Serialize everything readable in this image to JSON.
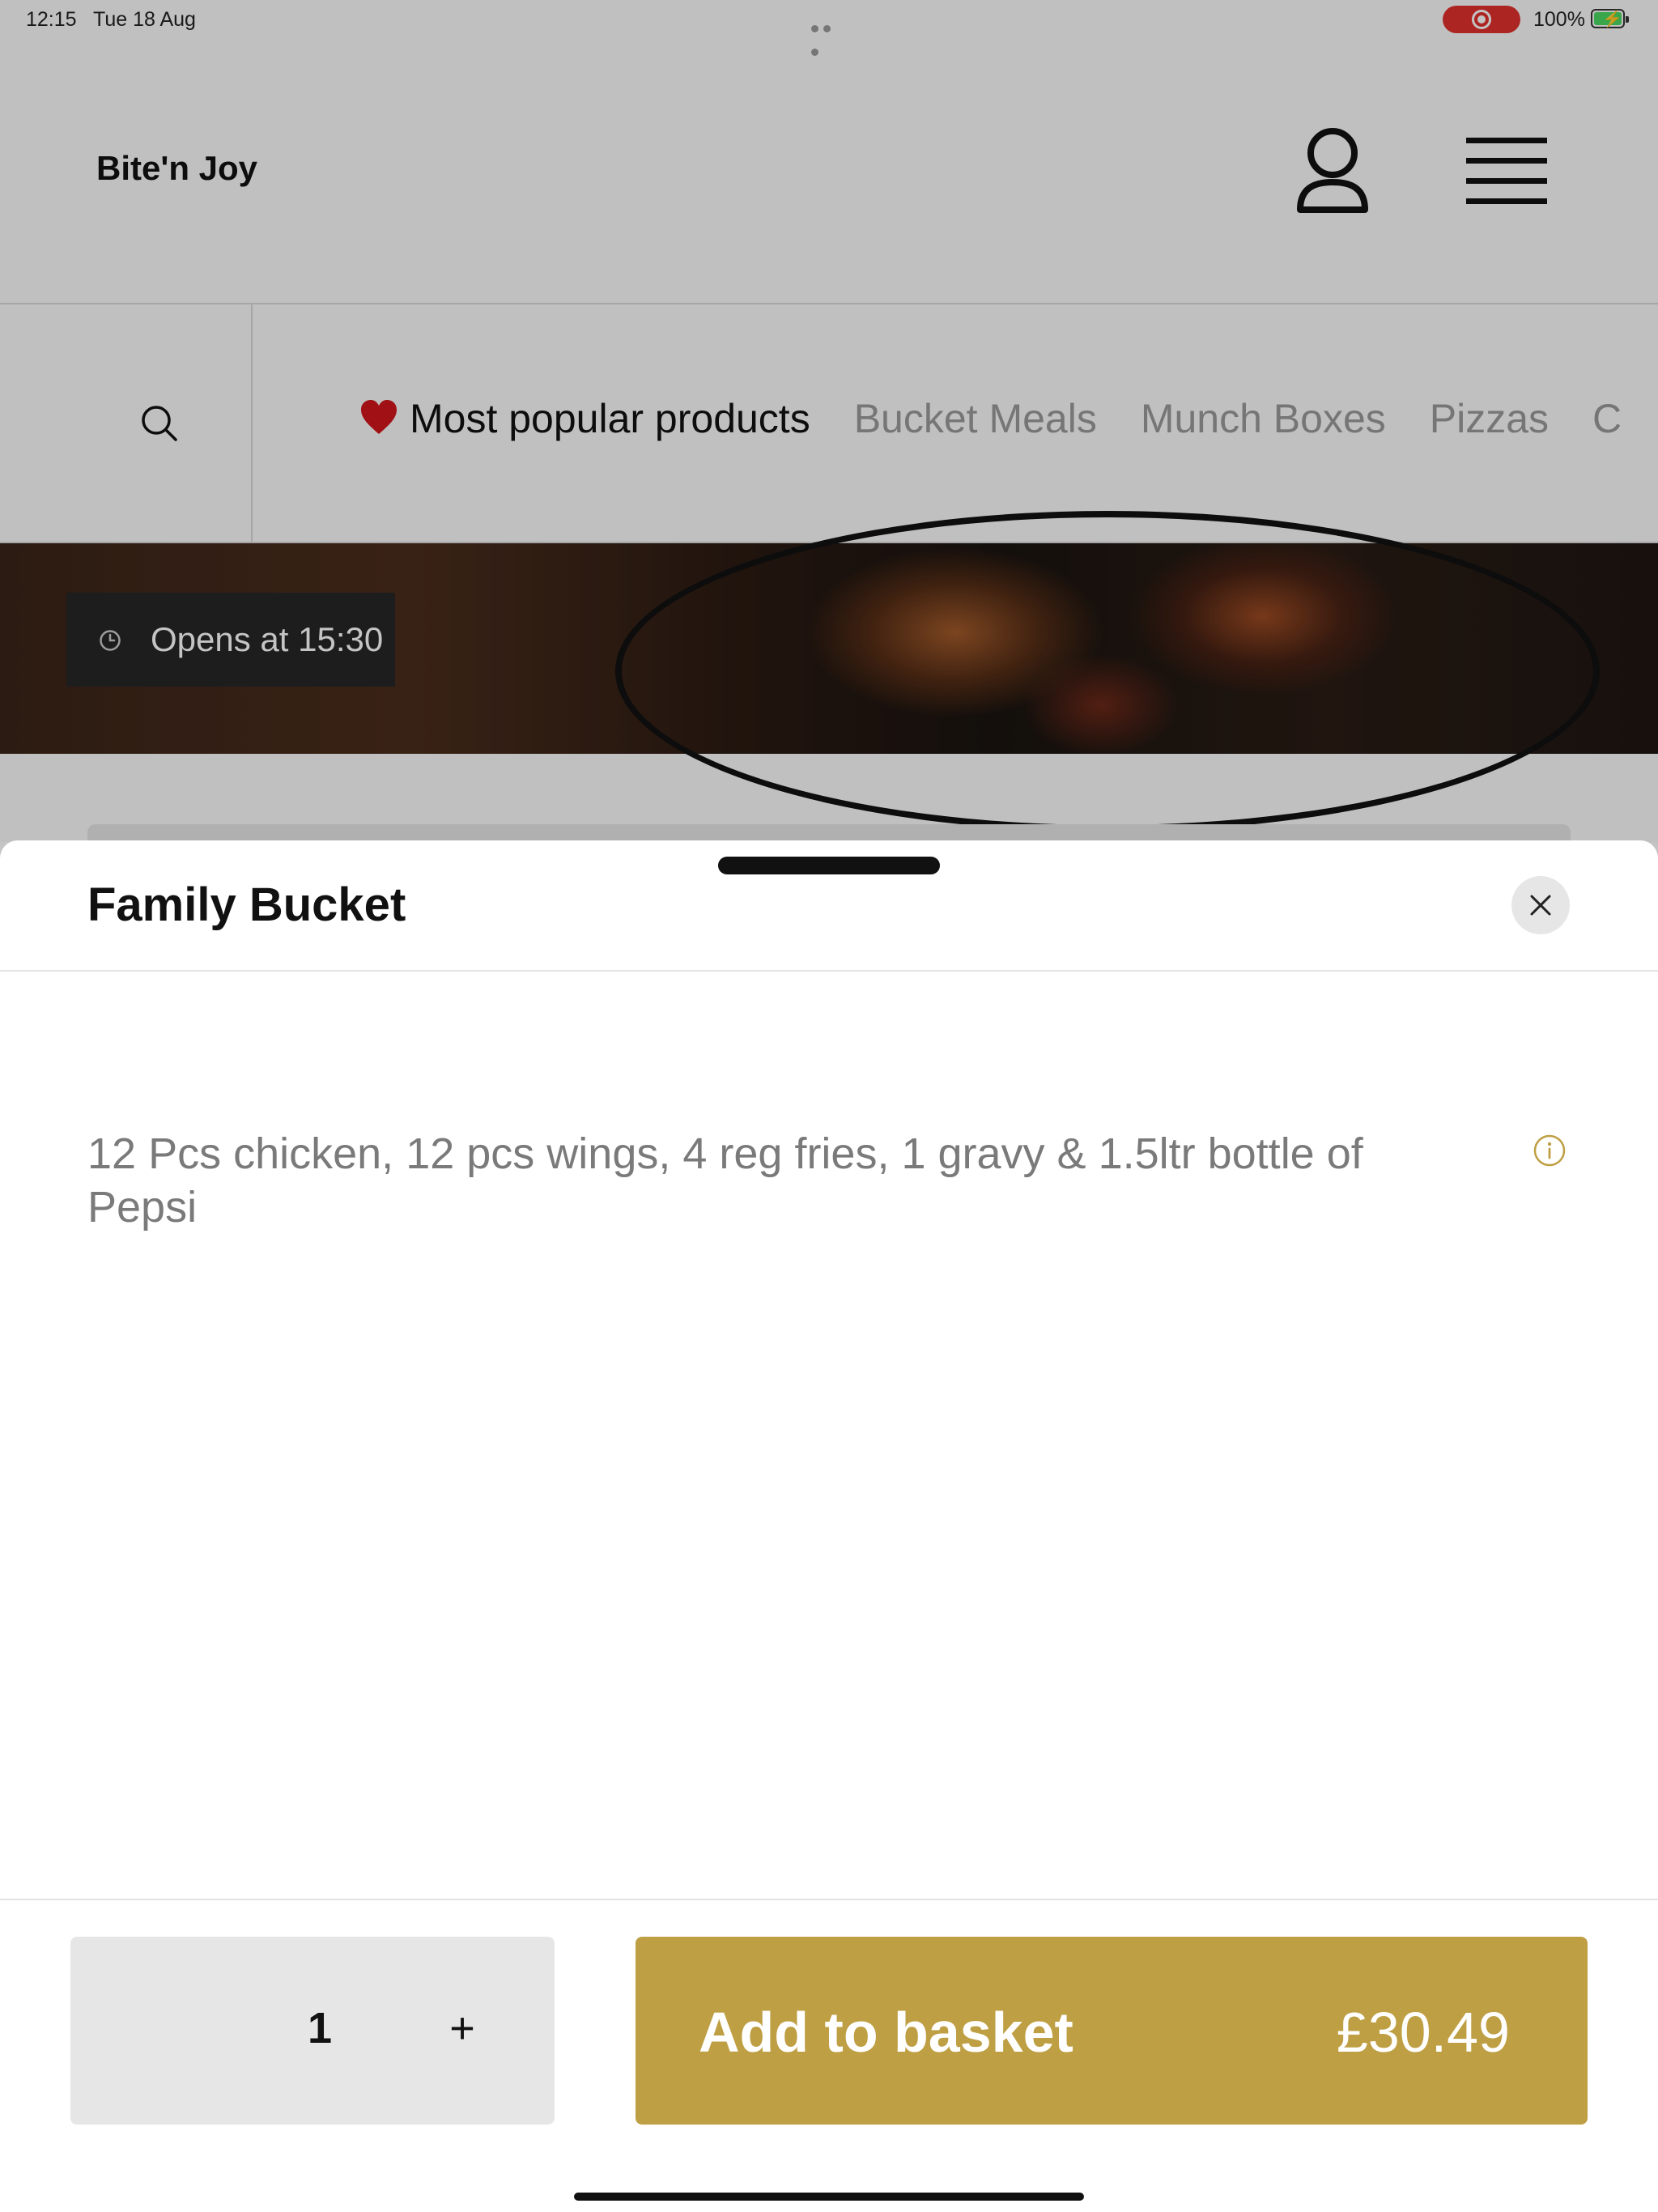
{
  "status_bar": {
    "time": "12:15",
    "date": "Tue 18 Aug",
    "battery": "100%"
  },
  "header": {
    "brand": "Bite'n Joy",
    "profile_icon": "user-icon",
    "menu_icon": "hamburger-menu-icon"
  },
  "categories": {
    "search_icon": "search-icon",
    "tabs": [
      {
        "label": "Most popular products",
        "icon": "heart-icon",
        "active": true
      },
      {
        "label": "Bucket Meals",
        "active": false
      },
      {
        "label": "Munch Boxes",
        "active": false
      },
      {
        "label": "Pizzas",
        "active": false
      },
      {
        "label": "C",
        "active": false
      }
    ]
  },
  "hero": {
    "opens_label": "Opens at 15:30",
    "clock_icon": "clock-icon"
  },
  "sheet": {
    "title": "Family Bucket",
    "close_icon": "close-icon",
    "description": "12  Pcs chicken, 12 pcs wings, 4 reg fries, 1 gravy & 1.5ltr bottle of Pepsi",
    "info_icon": "info-icon"
  },
  "footer": {
    "quantity": "1",
    "increment": "+",
    "add_label": "Add to basket",
    "price": "£30.49"
  },
  "colors": {
    "accent": "#bf9f44",
    "record": "#e0312d",
    "battery": "#4cd964"
  }
}
